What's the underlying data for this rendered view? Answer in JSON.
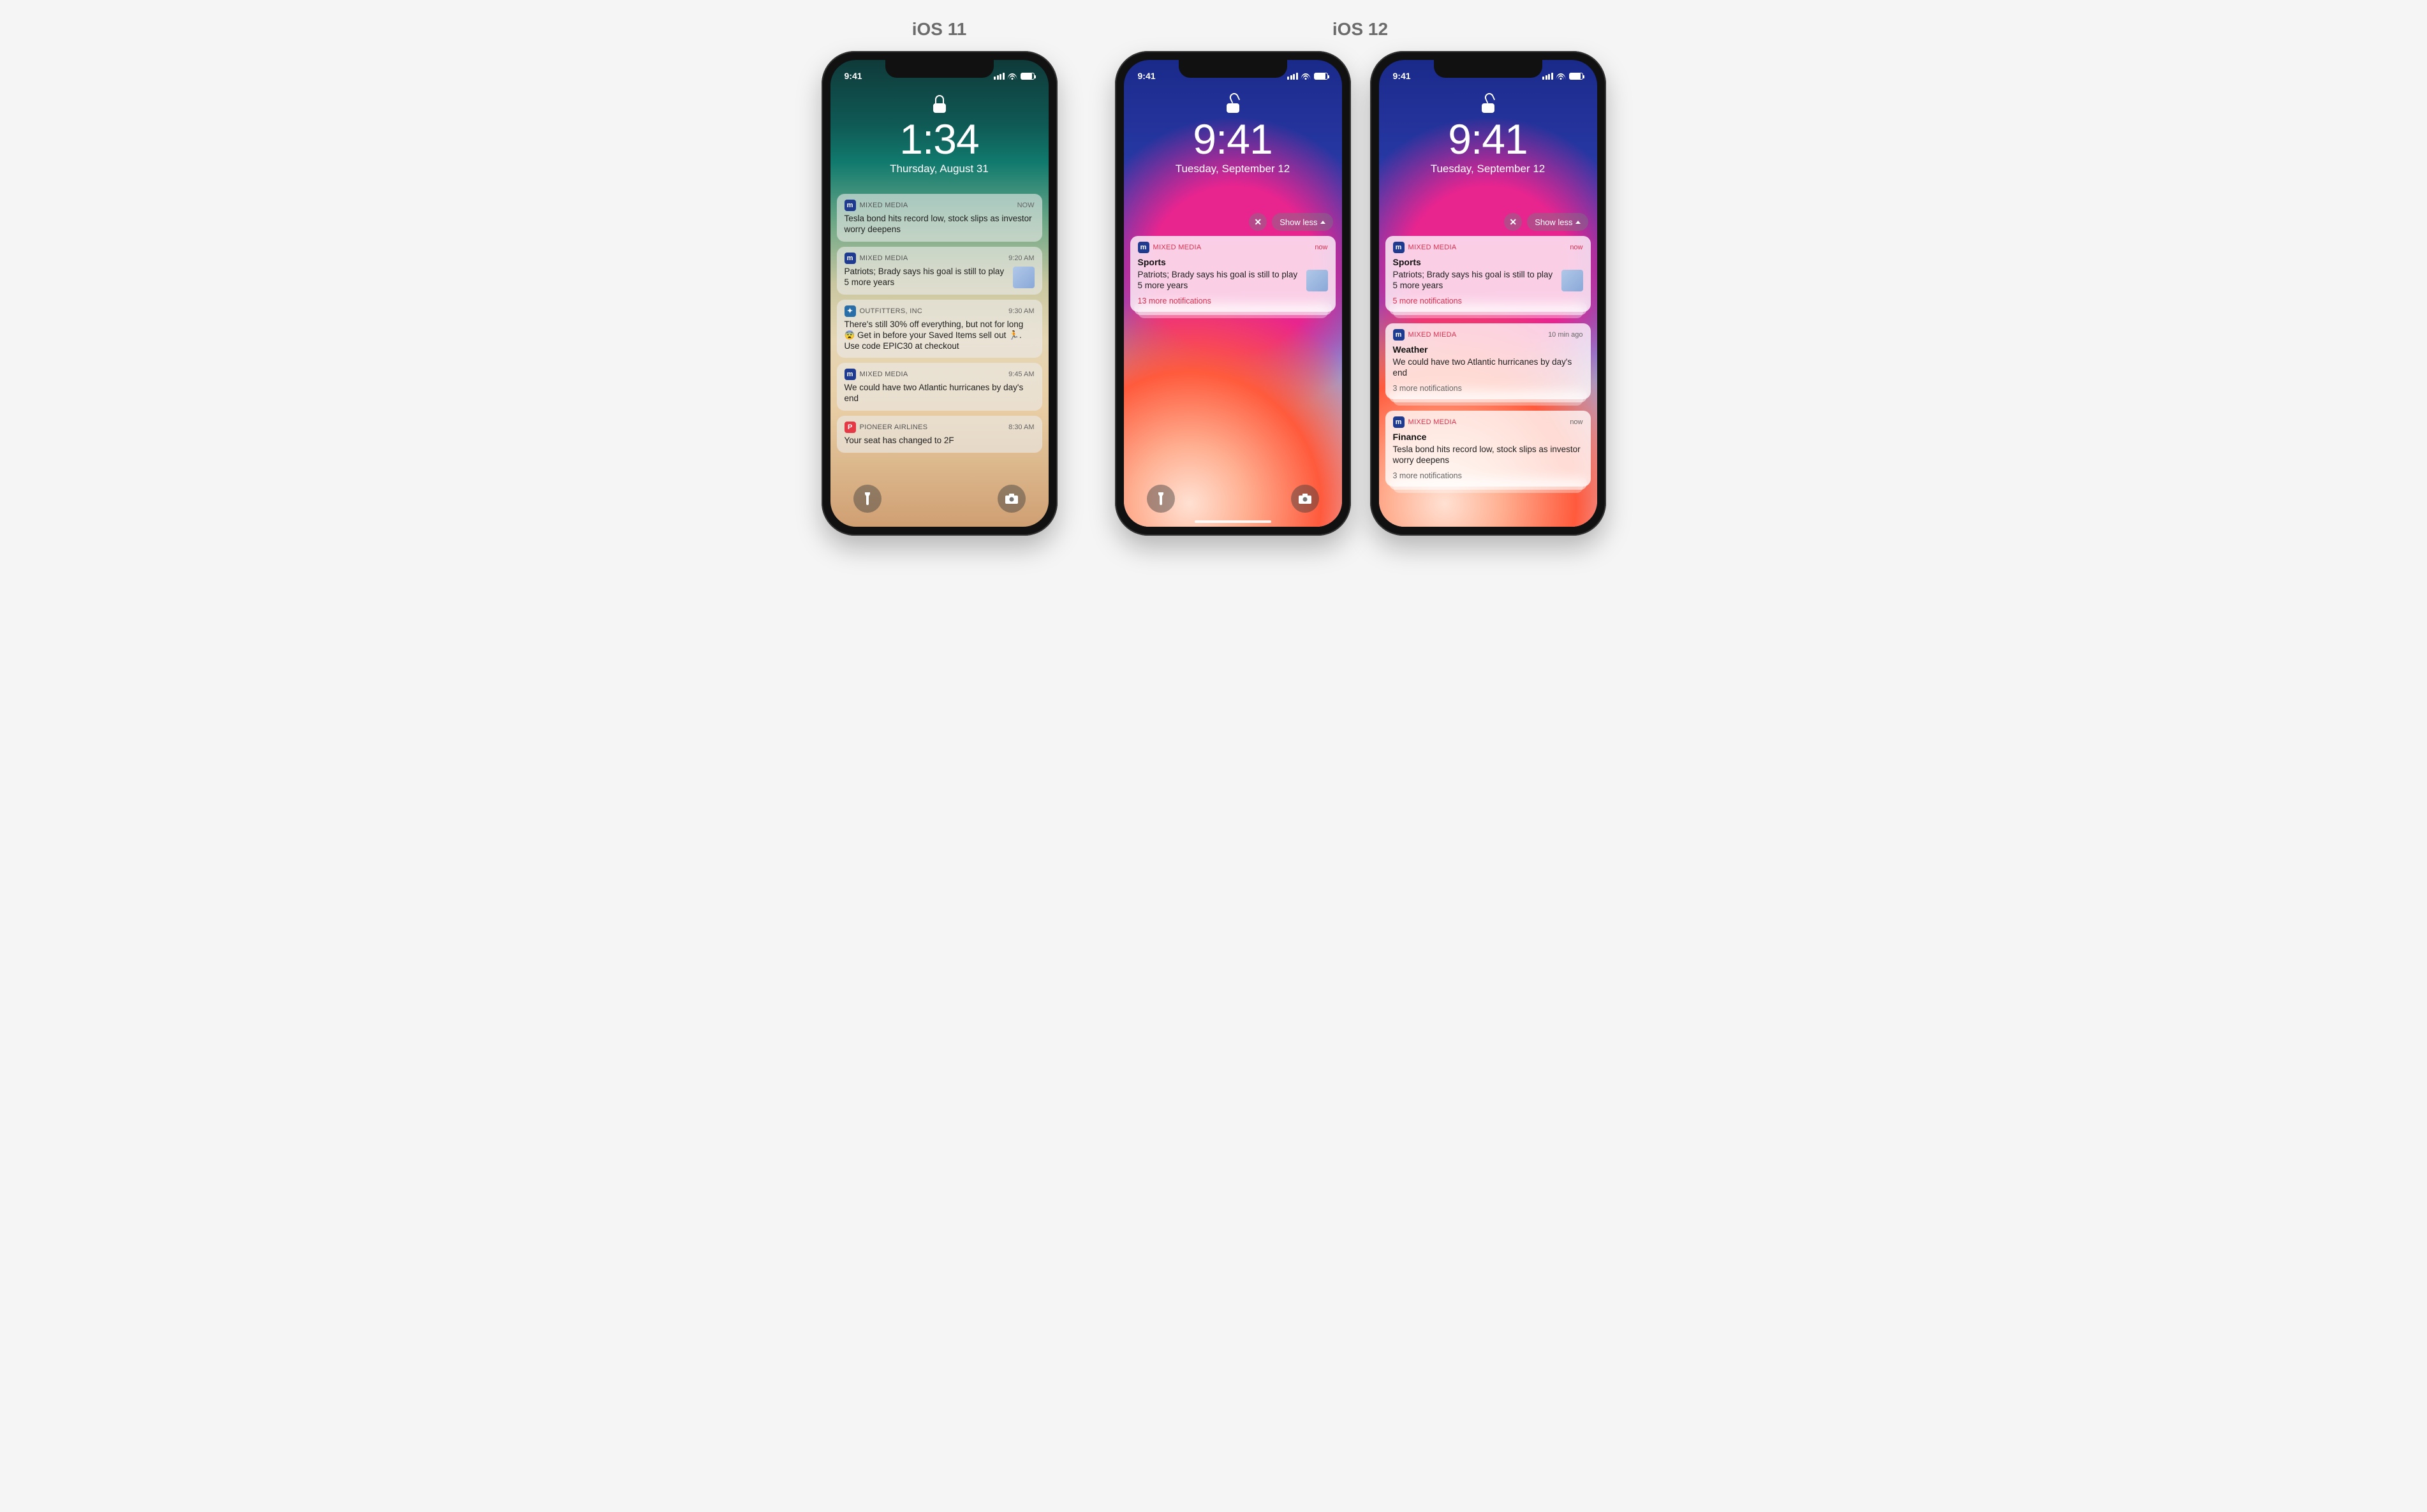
{
  "labels": {
    "ios11": "iOS 11",
    "ios12": "iOS 12"
  },
  "status_time": "9:41",
  "phone1": {
    "time": "1:34",
    "date": "Thursday, August 31",
    "locked": true,
    "notifs": [
      {
        "icon": "mm",
        "app": "MIXED MEDIA",
        "when": "NOW",
        "body": "Tesla bond hits record low, stock slips as investor worry deepens"
      },
      {
        "icon": "mm",
        "app": "MIXED MEDIA",
        "when": "9:20 AM",
        "body": "Patriots; Brady says his goal is still to play 5 more years",
        "thumb": true
      },
      {
        "icon": "out",
        "app": "OUTFITTERS, INC",
        "when": "9:30 AM",
        "body": "There's still 30% off everything, but not for long 😨 Get in before your Saved Items sell out 🏃. Use code EPIC30 at checkout"
      },
      {
        "icon": "mm",
        "app": "MIXED MEDIA",
        "when": "9:45 AM",
        "body": "We could have two Atlantic hurricanes by day's end"
      },
      {
        "icon": "pio",
        "app": "PIONEER AIRLINES",
        "when": "8:30 AM",
        "body": "Your seat has changed to 2F"
      }
    ]
  },
  "phone2": {
    "time": "9:41",
    "date": "Tuesday, September 12",
    "locked": false,
    "show_less": "Show less",
    "groups": [
      {
        "icon": "mm",
        "app": "MIXED MEDIA",
        "app_red": true,
        "when": "now",
        "when_red": true,
        "title": "Sports",
        "body": "Patriots; Brady says his goal is still to play 5 more years",
        "thumb": true,
        "more": "13 more notifications",
        "more_red": true,
        "stacked": true
      }
    ]
  },
  "phone3": {
    "time": "9:41",
    "date": "Tuesday, September 12",
    "locked": false,
    "show_less": "Show less",
    "groups": [
      {
        "icon": "mm",
        "app": "MIXED MEDIA",
        "app_red": true,
        "when": "now",
        "when_red": true,
        "title": "Sports",
        "body": "Patriots; Brady says his goal is still to play 5 more years",
        "thumb": true,
        "more": "5 more notifications",
        "more_red": true,
        "stacked": true
      },
      {
        "icon": "mm",
        "app": "MIXED MIEDA",
        "app_red": true,
        "when": "10 min ago",
        "title": "Weather",
        "body": "We could have two Atlantic hurricanes by day's end",
        "more": "3 more notifications",
        "stacked": true
      },
      {
        "icon": "mm",
        "app": "MIXED MEDIA",
        "app_red": true,
        "when": "now",
        "title": "Finance",
        "body": "Tesla bond hits record low, stock slips as investor worry deepens",
        "more": "3 more notifications",
        "stacked": true
      }
    ]
  }
}
